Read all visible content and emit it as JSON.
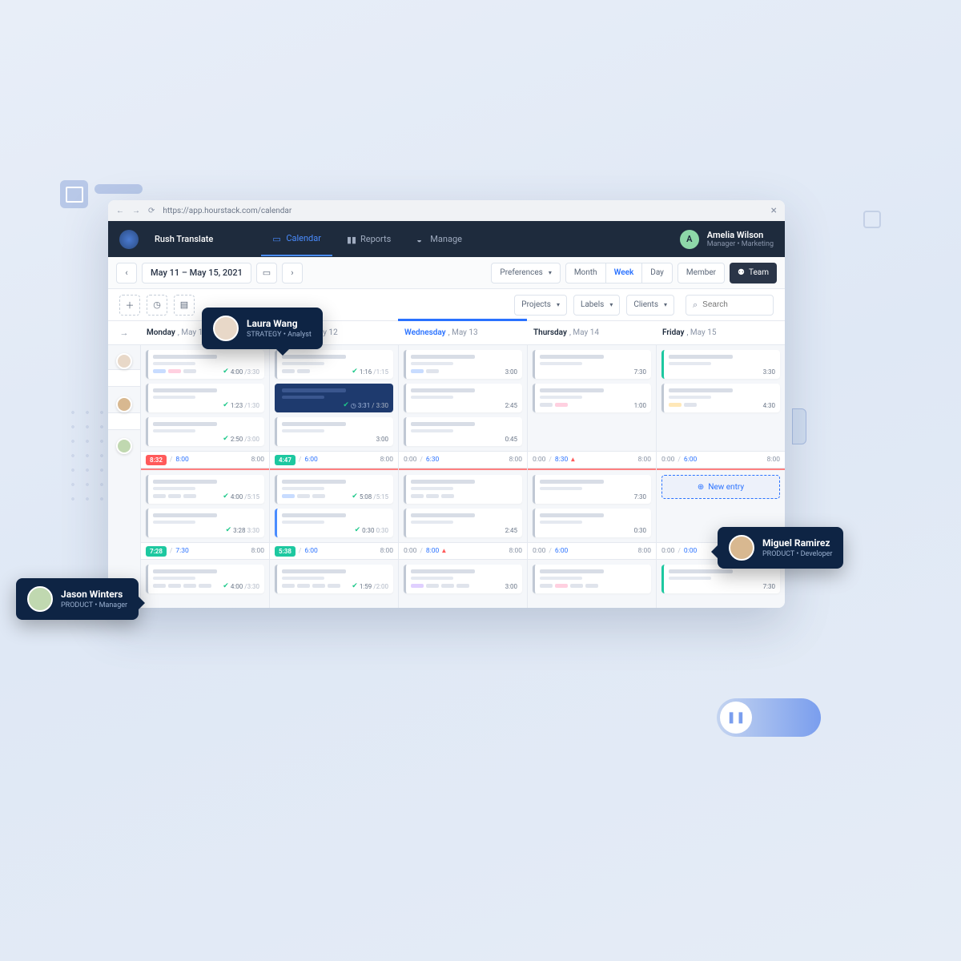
{
  "browser": {
    "url": "https://app.hourstack.com/calendar"
  },
  "header": {
    "workspace": "Rush Translate",
    "nav": {
      "calendar": "Calendar",
      "reports": "Reports",
      "manage": "Manage"
    },
    "user": {
      "initial": "A",
      "name": "Amelia Wilson",
      "role": "Manager • Marketing"
    }
  },
  "toolbar": {
    "date_range": "May 11 – May 15, 2021",
    "preferences": "Preferences",
    "views": {
      "month": "Month",
      "week": "Week",
      "day": "Day"
    },
    "member": "Member",
    "team": "Team"
  },
  "filters": {
    "projects": "Projects",
    "labels": "Labels",
    "clients": "Clients",
    "search_placeholder": "Search"
  },
  "days": [
    {
      "weekday": "Monday",
      "date": ", May 11"
    },
    {
      "weekday": "Tuesday",
      "date": ", May 12"
    },
    {
      "weekday": "Wednesday",
      "date": ", May 13"
    },
    {
      "weekday": "Thursday",
      "date": ", May 14"
    },
    {
      "weekday": "Friday",
      "date": ", May 15"
    }
  ],
  "rows": [
    {
      "id": "r1",
      "cells": [
        [
          {
            "t": "4:00",
            "tot": "/3:30",
            "chk": true,
            "tags": [
              "blue",
              "pink",
              ""
            ]
          },
          {
            "t": "1:23",
            "tot": "/1:30",
            "chk": true
          },
          {
            "t": "2:50",
            "tot": "/3:00",
            "chk": true
          }
        ],
        [
          {
            "t": "1:16",
            "tot": "/1:15",
            "chk": true,
            "tags": [
              "",
              ""
            ]
          },
          {
            "t": "3:31",
            "tot": "/ 3:30",
            "chk": true,
            "border": "active"
          },
          {
            "t": "3:00",
            "simple": true
          }
        ],
        [
          {
            "t": "3:00",
            "simple": true,
            "tags": [
              "blue",
              ""
            ]
          },
          {
            "t": "2:45",
            "simple": true
          },
          {
            "t": "0:45",
            "simple": true
          }
        ],
        [
          {
            "t": "7:30",
            "simple": true
          },
          {
            "t": "1:00",
            "simple": true,
            "tags": [
              "",
              "pink"
            ]
          }
        ],
        [
          {
            "t": "3:30",
            "simple": true,
            "border": "teal"
          },
          {
            "t": "4:30",
            "simple": true,
            "tags": [
              "yellow",
              ""
            ]
          }
        ]
      ],
      "summary": [
        {
          "badge": "8:32",
          "bclass": "red",
          "b": "8:00",
          "r": "8:00"
        },
        {
          "badge": "4:47",
          "bclass": "teal",
          "b": "6:00",
          "r": "8:00"
        },
        {
          "l": "0:00",
          "b": "6:30",
          "r": "8:00"
        },
        {
          "l": "0:00",
          "b": "8:30",
          "red_arrow": true,
          "r": "8:00"
        },
        {
          "l": "0:00",
          "b": "6:00",
          "r": "8:00"
        }
      ]
    },
    {
      "id": "r2",
      "cells": [
        [
          {
            "t": "4:00",
            "tot": "/5:15",
            "chk": true,
            "tags": [
              "",
              "",
              ""
            ]
          },
          {
            "t": "3:28",
            "tot": "3:30",
            "chk": true
          }
        ],
        [
          {
            "t": "5:08",
            "tot": "/5:15",
            "chk": true,
            "tags": [
              "blue",
              "",
              ""
            ]
          },
          {
            "t": "0:30",
            "tot": "0:30",
            "chk": true,
            "border": "blue"
          }
        ],
        [
          {
            "t": "",
            "simple": true,
            "tags": [
              "",
              "",
              ""
            ]
          },
          {
            "t": "2:45",
            "simple": true
          }
        ],
        [
          {
            "t": "7:30",
            "simple": true
          },
          {
            "t": "0:30",
            "simple": true
          }
        ],
        [
          {
            "new_entry": true
          }
        ]
      ],
      "summary": [
        {
          "badge": "7:28",
          "bclass": "teal",
          "b": "7:30",
          "r": "8:00"
        },
        {
          "badge": "5:38",
          "bclass": "teal",
          "b": "6:00",
          "r": "8:00"
        },
        {
          "l": "0:00",
          "b": "8:00",
          "red_arrow": true,
          "r": "8:00"
        },
        {
          "l": "0:00",
          "b": "6:00",
          "r": "8:00"
        },
        {
          "l": "0:00",
          "b": "0:00",
          "r": "8:00"
        }
      ]
    },
    {
      "id": "r3",
      "cells": [
        [
          {
            "t": "4:00",
            "tot": "/3:30",
            "chk": true,
            "tags": [
              "",
              "",
              "",
              ""
            ]
          }
        ],
        [
          {
            "t": "1:59",
            "tot": "/2:00",
            "chk": true,
            "tags": [
              "",
              "",
              "",
              ""
            ]
          }
        ],
        [
          {
            "t": "3:00",
            "simple": true,
            "tags": [
              "purple",
              "",
              "",
              ""
            ]
          }
        ],
        [
          {
            "t": "",
            "simple": true,
            "tags": [
              "",
              "pink",
              "",
              ""
            ]
          }
        ],
        [
          {
            "t": "7:30",
            "simple": true,
            "border": "teal"
          }
        ]
      ]
    }
  ],
  "new_entry_label": "New entry",
  "callouts": {
    "laura": {
      "name": "Laura Wang",
      "role": "STRATEGY • Analyst"
    },
    "jason": {
      "name": "Jason Winters",
      "role": "PRODUCT • Manager"
    },
    "miguel": {
      "name": "Miguel Ramirez",
      "role": "PRODUCT • Developer"
    }
  }
}
